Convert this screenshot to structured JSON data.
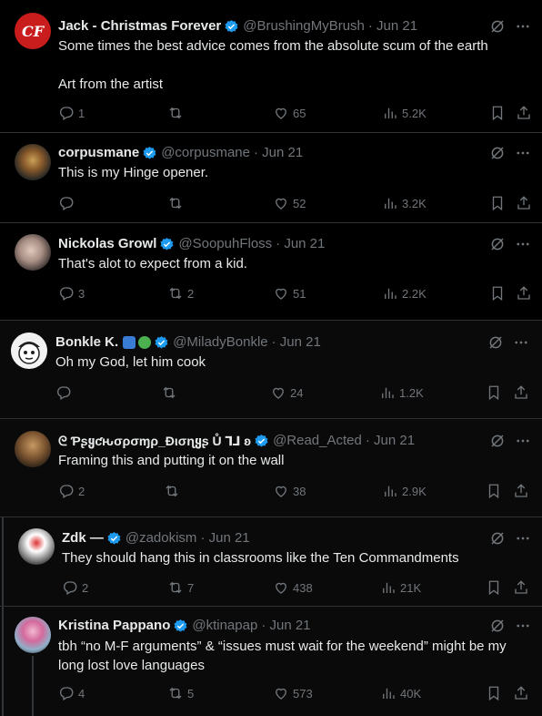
{
  "tweets": [
    {
      "author": "Jack - Christmas Forever",
      "handle": "@BrushingMyBrush",
      "date": "· Jun 21",
      "avatar_text": "CF",
      "text": "Some times the best advice comes from the absolute scum of the earth\n\nArt from the artist",
      "replies": "1",
      "retweets": "",
      "likes": "65",
      "views": "5.2K"
    },
    {
      "author": "corpusmane",
      "handle": "@corpusmane",
      "date": "· Jun 21",
      "text": "This is my Hinge opener.",
      "replies": "",
      "retweets": "",
      "likes": "52",
      "views": "3.2K"
    },
    {
      "author": "Nickolas Growl",
      "handle": "@SoopuhFloss",
      "date": "· Jun 21",
      "text": "That's alot to expect from a kid.",
      "replies": "3",
      "retweets": "2",
      "likes": "51",
      "views": "2.2K"
    },
    {
      "author": "Bonkle K.",
      "handle": "@MiladyBonkle",
      "date": "· Jun 21",
      "text": "Oh my God, let him cook",
      "replies": "",
      "retweets": "",
      "likes": "24",
      "views": "1.2K"
    },
    {
      "author": "ᘓ Ƥʂყƈԋσρσɱρ_Ðισɳყʂ Ů ⅂⅃ ʚ",
      "handle": "@Read_Acted",
      "date": "· Jun 21",
      "text": "Framing this and putting it on the wall",
      "replies": "2",
      "retweets": "",
      "likes": "38",
      "views": "2.9K"
    },
    {
      "author": "Zdk —",
      "handle": "@zadokism",
      "date": "· Jun 21",
      "text": "They should hang this in classrooms like the Ten Commandments",
      "replies": "2",
      "retweets": "7",
      "likes": "438",
      "views": "21K"
    },
    {
      "author": "Kristina Pappano",
      "handle": "@ktinapap",
      "date": "· Jun 21",
      "text": "tbh “no M-F arguments” & “issues must wait for the weekend” might be my long lost love languages",
      "replies": "4",
      "retweets": "5",
      "likes": "573",
      "views": "40K"
    }
  ],
  "colors": {
    "background": "#000000",
    "text": "#e7e9ea",
    "muted": "#71767b",
    "divider": "#2f3336",
    "verified": "#1d9bf0"
  }
}
